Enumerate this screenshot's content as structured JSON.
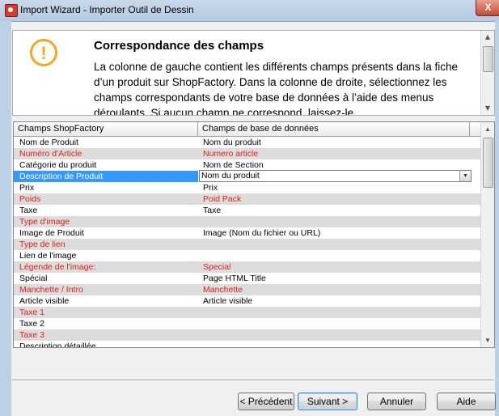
{
  "window": {
    "title": "Import Wizard - Importer Outil de Dessin",
    "close_glyph": "X"
  },
  "header": {
    "icon": "warning-icon",
    "icon_glyph": "!",
    "title": "Correspondance des champs",
    "description": "La colonne de gauche contient les différents champs présents dans la fiche d’un produit sur ShopFactory. Dans la colonne de droite, sélectionnez les champs correspondants de votre base de données à l’aide des menus déroulants. Si aucun champ ne correspond, laissez-le"
  },
  "grid": {
    "columns": [
      "Champs ShopFactory",
      "Champs de base de données"
    ],
    "rows": [
      {
        "left": "Nom de Produit",
        "right": "Nom du produit",
        "red": false,
        "shade": false
      },
      {
        "left": "Numéro d'Article",
        "right": "Numero article",
        "red": true,
        "shade": true
      },
      {
        "left": "Catégorie du produit",
        "right": "Nom de Section",
        "red": false,
        "shade": false
      },
      {
        "left": "Description de Produit",
        "right": "Nom du produit",
        "red": false,
        "shade": false,
        "selected": true
      },
      {
        "left": "Prix",
        "right": "Prix",
        "red": false,
        "shade": false
      },
      {
        "left": "Poids",
        "right": "Poid Pack",
        "red": true,
        "shade": true
      },
      {
        "left": "Taxe",
        "right": "Taxe",
        "red": false,
        "shade": false
      },
      {
        "left": "Type d'image",
        "right": "",
        "red": true,
        "shade": true
      },
      {
        "left": "Image de Produit",
        "right": "Image (Nom du fichier ou URL)",
        "red": false,
        "shade": false
      },
      {
        "left": "Type de lien",
        "right": "",
        "red": true,
        "shade": true
      },
      {
        "left": "Lien de l'image",
        "right": "",
        "red": false,
        "shade": false
      },
      {
        "left": "Légende de l'image:",
        "right": "Special",
        "red": true,
        "shade": true
      },
      {
        "left": "Spécial",
        "right": "Page HTML Title",
        "red": false,
        "shade": false
      },
      {
        "left": "Manchette / Intro",
        "right": "Manchette",
        "red": true,
        "shade": true
      },
      {
        "left": "Article visible",
        "right": "Article visible",
        "red": false,
        "shade": false
      },
      {
        "left": "Taxe 1",
        "right": "",
        "red": true,
        "shade": true
      },
      {
        "left": "Taxe 2",
        "right": "",
        "red": false,
        "shade": false
      },
      {
        "left": "Taxe 3",
        "right": "",
        "red": true,
        "shade": true
      },
      {
        "left": "Description détaillée",
        "right": "",
        "red": false,
        "shade": false
      }
    ]
  },
  "buttons": {
    "previous": "< Précédent",
    "next": "Suivant >",
    "cancel": "Annuler",
    "help": "Aide"
  },
  "colors": {
    "required_text": "#d9221c",
    "selection": "#3399ff",
    "warning": "#f5a623"
  }
}
